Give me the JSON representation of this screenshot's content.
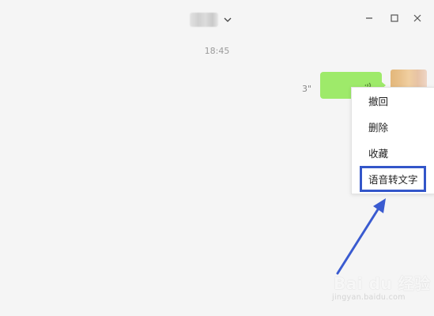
{
  "header": {
    "contact_name": "",
    "icons": {
      "dropdown": "chevron-down-icon",
      "minimize": "minimize-icon",
      "maximize": "maximize-icon",
      "close": "close-icon"
    }
  },
  "chat": {
    "timestamp": "18:45",
    "voice_message": {
      "duration": "3\"",
      "bubble_color": "#9eea6a",
      "icon": "voice-wave-icon"
    }
  },
  "context_menu": {
    "items": [
      {
        "label": "撤回"
      },
      {
        "label": "删除"
      },
      {
        "label": "收藏"
      },
      {
        "label": "语音转文字"
      }
    ],
    "highlight_color": "#3356c9"
  },
  "watermark": {
    "logo_text": "Bai du 经验",
    "sub_text": "jingyan.baidu.com"
  }
}
